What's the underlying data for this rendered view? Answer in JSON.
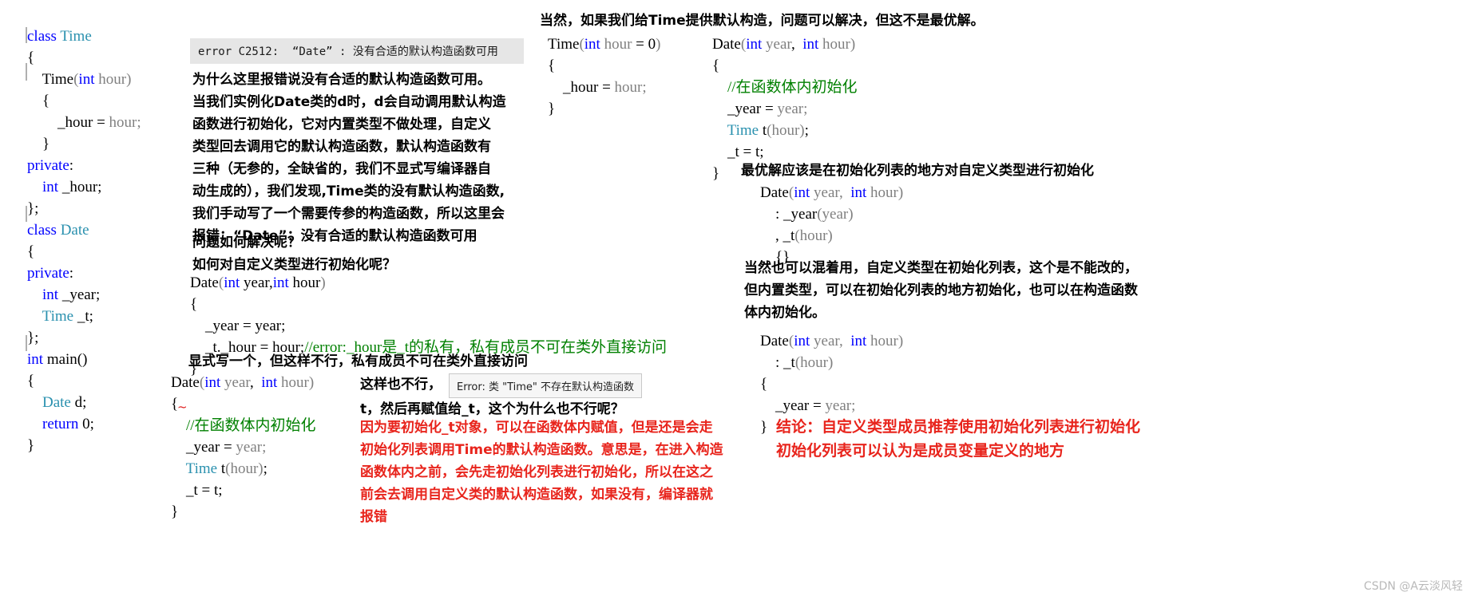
{
  "page": {
    "watermark": "CSDN @A云淡风轻"
  },
  "left_code": {
    "lines": [
      [
        {
          "t": "class ",
          "c": "kw"
        },
        {
          "t": "Time",
          "c": "typ"
        }
      ],
      [
        {
          "t": "{",
          "c": "plain"
        }
      ],
      [
        {
          "t": "    Time",
          "c": "plain"
        },
        {
          "t": "(",
          "c": "id"
        },
        {
          "t": "int",
          "c": "kw"
        },
        {
          "t": " hour",
          "c": "id"
        },
        {
          "t": ")",
          "c": "id"
        }
      ],
      [
        {
          "t": "    {",
          "c": "plain"
        }
      ],
      [
        {
          "t": "        _hour = ",
          "c": "plain"
        },
        {
          "t": "hour;",
          "c": "id"
        }
      ],
      [
        {
          "t": "    }",
          "c": "plain"
        }
      ],
      [
        {
          "t": "private",
          "c": "kw"
        },
        {
          "t": ":",
          "c": "plain"
        }
      ],
      [
        {
          "t": "    ",
          "c": "plain"
        },
        {
          "t": "int",
          "c": "kw"
        },
        {
          "t": " _hour;",
          "c": "plain"
        }
      ],
      [
        {
          "t": "};",
          "c": "plain"
        }
      ],
      [
        {
          "t": "",
          "c": "plain"
        }
      ],
      [
        {
          "t": "class ",
          "c": "kw"
        },
        {
          "t": "Date",
          "c": "typ"
        }
      ],
      [
        {
          "t": "{",
          "c": "plain"
        }
      ],
      [
        {
          "t": "private",
          "c": "kw"
        },
        {
          "t": ":",
          "c": "plain"
        }
      ],
      [
        {
          "t": "    ",
          "c": "plain"
        },
        {
          "t": "int",
          "c": "kw"
        },
        {
          "t": " _year;",
          "c": "plain"
        }
      ],
      [
        {
          "t": "    ",
          "c": "plain"
        },
        {
          "t": "Time",
          "c": "typ"
        },
        {
          "t": " _t;",
          "c": "plain"
        }
      ],
      [
        {
          "t": "};",
          "c": "plain"
        }
      ],
      [
        {
          "t": "",
          "c": "plain"
        }
      ],
      [
        {
          "t": "int",
          "c": "kw"
        },
        {
          "t": " main()",
          "c": "plain"
        }
      ],
      [
        {
          "t": "{",
          "c": "plain"
        }
      ],
      [
        {
          "t": "    ",
          "c": "plain"
        },
        {
          "t": "Date",
          "c": "typ"
        },
        {
          "t": " d;",
          "c": "plain"
        }
      ],
      [
        {
          "t": "    ",
          "c": "plain"
        },
        {
          "t": "return",
          "c": "kw"
        },
        {
          "t": " ",
          "c": "plain"
        },
        {
          "t": "0",
          "c": "num"
        },
        {
          "t": ";",
          "c": "plain"
        }
      ],
      [
        {
          "t": "}",
          "c": "plain"
        }
      ]
    ]
  },
  "error_box": {
    "text": "error C2512:  “Date” : 没有合适的默认构造函数可用"
  },
  "explain_paragraph": {
    "lines": [
      "为什么这里报错说没有合适的默认构造函数可用。",
      "当我们实例化Date类的d时，d会自动调用默认构造",
      "函数进行初始化，它对内置类型不做处理，自定义",
      "类型回去调用它的默认构造函数，默认构造函数有",
      "三种（无参的，全缺省的，我们不显式写编译器自",
      "动生成的），我们发现,Time类的没有默认构造函数,",
      "我们手动写了一个需要传参的构造函数，所以这里会",
      "报错：“Date”：没有合适的默认构造函数可用"
    ]
  },
  "question_block": {
    "lines": [
      "问题如何解决呢？",
      "如何对自定义类型进行初始化呢？"
    ]
  },
  "mid_code_1": {
    "lines": [
      [
        {
          "t": "Date",
          "c": "plain"
        },
        {
          "t": "(",
          "c": "id"
        },
        {
          "t": "int",
          "c": "kw"
        },
        {
          "t": " year,",
          "c": "plain"
        },
        {
          "t": "int",
          "c": "kw"
        },
        {
          "t": " hour",
          "c": "plain"
        },
        {
          "t": ")",
          "c": "id"
        }
      ],
      [
        {
          "t": "{",
          "c": "plain"
        }
      ],
      [
        {
          "t": "    _year = year;",
          "c": "plain"
        }
      ],
      [
        {
          "t": "    _t._hour = hour;",
          "c": "plain"
        },
        {
          "t": "//error:_hour是_t的私有，私有成员不可在类外直接访问",
          "c": "cmt"
        }
      ],
      [
        {
          "t": "}",
          "c": "plain"
        }
      ]
    ]
  },
  "note_1": {
    "text": "显式写一个，但这样不行，私有成员不可在类外直接访问"
  },
  "mid_code_2": {
    "lines": [
      [
        {
          "t": "Date",
          "c": "plain"
        },
        {
          "t": "(",
          "c": "id"
        },
        {
          "t": "int",
          "c": "kw"
        },
        {
          "t": " year",
          "c": "id"
        },
        {
          "t": ",  ",
          "c": "plain"
        },
        {
          "t": "int",
          "c": "kw"
        },
        {
          "t": " hour",
          "c": "id"
        },
        {
          "t": ")",
          "c": "id"
        }
      ],
      [
        {
          "t": "{",
          "c": "plain"
        }
      ],
      [
        {
          "t": "    ",
          "c": "plain"
        },
        {
          "t": "//在函数体内初始化",
          "c": "cmt"
        }
      ],
      [
        {
          "t": "    _year = ",
          "c": "plain"
        },
        {
          "t": "year;",
          "c": "id"
        }
      ],
      [
        {
          "t": "    ",
          "c": "plain"
        },
        {
          "t": "Time",
          "c": "typ"
        },
        {
          "t": " t",
          "c": "plain"
        },
        {
          "t": "(hour)",
          "c": "id"
        },
        {
          "t": ";",
          "c": "plain"
        }
      ],
      [
        {
          "t": "    _t = t;",
          "c": "plain"
        }
      ],
      [
        {
          "t": "}",
          "c": "plain"
        }
      ]
    ]
  },
  "note_2": {
    "text": "这样也不行，"
  },
  "tooltip_1": {
    "text": "Error: 类 \"Time\" 不存在默认构造函数"
  },
  "note_3": {
    "text": "t，然后再赋值给_t，这个为什么也不行呢？"
  },
  "red_paragraph_mid": {
    "lines": [
      "因为要初始化_t对象，可以在函数体内赋值，但是还是会走",
      "初始化列表调用Time的默认构造函数。意思是，在进入构造",
      "函数体内之前，会先走初始化列表进行初始化，所以在这之",
      "前会去调用自定义类的默认构造函数，如果没有，编译器就",
      "报错"
    ]
  },
  "right_heading": {
    "text": "当然，如果我们给Time提供默认构造，问题可以解决，但这不是最优解。"
  },
  "right_code_time": {
    "lines": [
      [
        {
          "t": "Time",
          "c": "plain"
        },
        {
          "t": "(",
          "c": "id"
        },
        {
          "t": "int",
          "c": "kw"
        },
        {
          "t": " hour ",
          "c": "id"
        },
        {
          "t": "= ",
          "c": "plain"
        },
        {
          "t": "0",
          "c": "num"
        },
        {
          "t": ")",
          "c": "id"
        }
      ],
      [
        {
          "t": "{",
          "c": "plain"
        }
      ],
      [
        {
          "t": "    _hour = ",
          "c": "plain"
        },
        {
          "t": "hour;",
          "c": "id"
        }
      ],
      [
        {
          "t": "}",
          "c": "plain"
        }
      ]
    ]
  },
  "right_code_date": {
    "lines": [
      [
        {
          "t": "Date",
          "c": "plain"
        },
        {
          "t": "(",
          "c": "id"
        },
        {
          "t": "int",
          "c": "kw"
        },
        {
          "t": " year",
          "c": "id"
        },
        {
          "t": ",  ",
          "c": "plain"
        },
        {
          "t": "int",
          "c": "kw"
        },
        {
          "t": " hour",
          "c": "id"
        },
        {
          "t": ")",
          "c": "id"
        }
      ],
      [
        {
          "t": "{",
          "c": "plain"
        }
      ],
      [
        {
          "t": "    ",
          "c": "plain"
        },
        {
          "t": "//在函数体内初始化",
          "c": "cmt"
        }
      ],
      [
        {
          "t": "    _year = ",
          "c": "plain"
        },
        {
          "t": "year;",
          "c": "id"
        }
      ],
      [
        {
          "t": "    ",
          "c": "plain"
        },
        {
          "t": "Time",
          "c": "typ"
        },
        {
          "t": " t",
          "c": "plain"
        },
        {
          "t": "(hour)",
          "c": "id"
        },
        {
          "t": ";",
          "c": "plain"
        }
      ],
      [
        {
          "t": "    _t = t;",
          "c": "plain"
        }
      ],
      [
        {
          "t": "",
          "c": "plain"
        }
      ],
      [
        {
          "t": "}",
          "c": "plain"
        }
      ]
    ]
  },
  "right_note_1": {
    "text": "最优解应该是在初始化列表的地方对自定义类型进行初始化"
  },
  "right_code_best": {
    "lines": [
      [
        {
          "t": "Date",
          "c": "plain"
        },
        {
          "t": "(",
          "c": "id"
        },
        {
          "t": "int",
          "c": "kw"
        },
        {
          "t": " year,  ",
          "c": "id"
        },
        {
          "t": "int",
          "c": "kw"
        },
        {
          "t": " hour",
          "c": "id"
        },
        {
          "t": ")",
          "c": "id"
        }
      ],
      [
        {
          "t": "    : _year",
          "c": "plain"
        },
        {
          "t": "(year)",
          "c": "id"
        }
      ],
      [
        {
          "t": "    , _t",
          "c": "plain"
        },
        {
          "t": "(hour)",
          "c": "id"
        }
      ],
      [
        {
          "t": "    {}",
          "c": "plain"
        }
      ]
    ]
  },
  "right_paragraph": {
    "lines": [
      "当然也可以混着用，自定义类型在初始化列表，这个是不能改的，",
      "但内置类型，可以在初始化列表的地方初始化，也可以在构造函数",
      "体内初始化。"
    ]
  },
  "right_code_mixed": {
    "lines": [
      [
        {
          "t": "Date",
          "c": "plain"
        },
        {
          "t": "(",
          "c": "id"
        },
        {
          "t": "int",
          "c": "kw"
        },
        {
          "t": " year,  ",
          "c": "id"
        },
        {
          "t": "int",
          "c": "kw"
        },
        {
          "t": " hour",
          "c": "id"
        },
        {
          "t": ")",
          "c": "id"
        }
      ],
      [
        {
          "t": "    : _t",
          "c": "plain"
        },
        {
          "t": "(hour)",
          "c": "id"
        }
      ],
      [
        {
          "t": "{",
          "c": "plain"
        }
      ],
      [
        {
          "t": "",
          "c": "plain"
        }
      ],
      [
        {
          "t": "    _year = ",
          "c": "plain"
        },
        {
          "t": "year;",
          "c": "id"
        }
      ],
      [
        {
          "t": "",
          "c": "plain"
        }
      ],
      [
        {
          "t": "}",
          "c": "plain"
        }
      ]
    ]
  },
  "conclusion": {
    "lines": [
      "结论：自定义类型成员推荐使用初始化列表进行初始化",
      "初始化列表可以认为是成员变量定义的地方"
    ]
  }
}
